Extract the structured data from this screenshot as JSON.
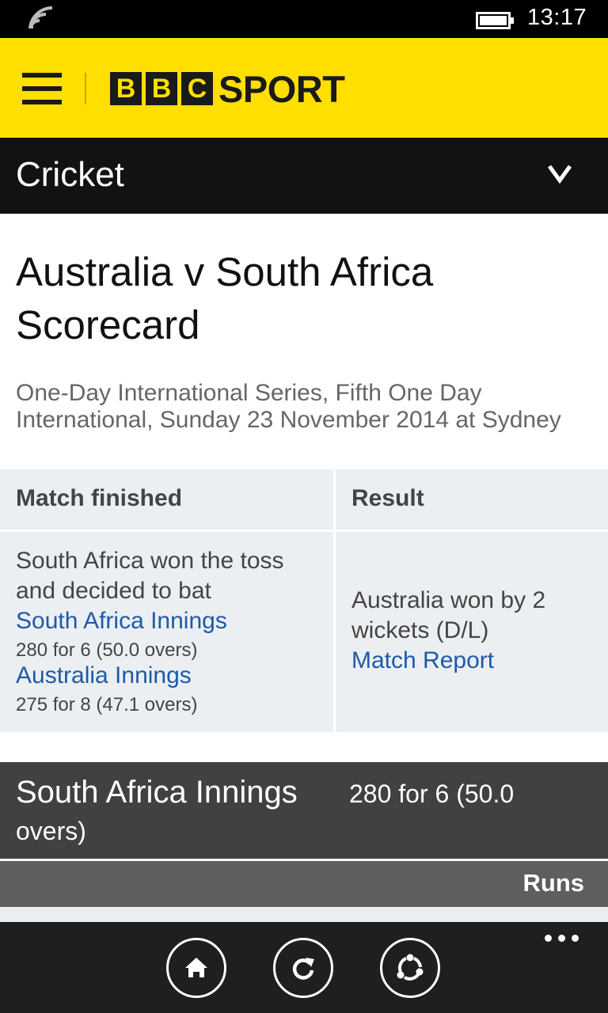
{
  "status_bar": {
    "time": "13:17",
    "icons": [
      "signal-icon",
      "battery-icon"
    ]
  },
  "header": {
    "logo_letters": [
      "B",
      "B",
      "C"
    ],
    "logo_word": "SPORT",
    "brand_color": "#ffdf00",
    "icons": [
      "hamburger-menu-icon"
    ]
  },
  "section": {
    "title": "Cricket",
    "icons": [
      "chevron-down-icon"
    ]
  },
  "page": {
    "title": "Australia v South Africa Scorecard",
    "subtitle": "One-Day International Series, Fifth One Day International, Sunday 23 November 2014 at Sydney"
  },
  "summary": {
    "status_header": "Match finished",
    "result_header": "Result",
    "toss": "South Africa won the toss and decided to bat",
    "innings": [
      {
        "label": "South Africa Innings",
        "score": "280 for 6 (50.0 overs)"
      },
      {
        "label": "Australia Innings",
        "score": "275 for 8 (47.1 overs)"
      }
    ],
    "result": "Australia won by 2 wickets (D/L)",
    "match_report": "Match Report",
    "link_color": "#1e5aa8"
  },
  "innings_section": {
    "name": "South Africa Innings",
    "score": "280 for 6 (50.0",
    "overs_continuation": "overs)",
    "column_header": "Runs"
  },
  "app_bar": {
    "buttons": [
      "home-icon",
      "refresh-icon",
      "share-icon"
    ],
    "more": "more-icon"
  }
}
